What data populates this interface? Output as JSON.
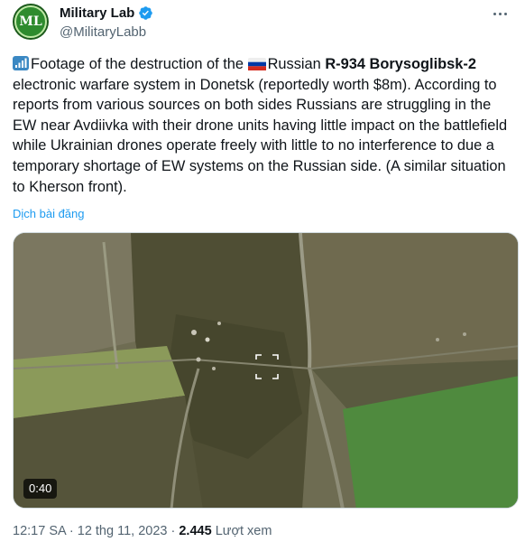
{
  "author": {
    "display_name": "Military Lab",
    "handle": "@MilitaryLabb",
    "avatar_text": "ML",
    "verified": true
  },
  "tweet": {
    "text_prefix": "Footage of the destruction of the ",
    "text_after_flag": "Russian ",
    "bold_system": "R-934 Borysoglibsk-2",
    "text_rest": " electronic warfare system in Donetsk (reportedly worth $8m). According to reports from various sources on both sides Russians are struggling in the EW near Avdiivka with their drone units having little impact on the battlefield while Ukrainian drones operate freely with little to no interference to due a temporary shortage of EW systems on the Russian side. (A similar situation to Kherson front).",
    "translate_label": "Dịch bài đăng"
  },
  "media": {
    "duration": "0:40"
  },
  "meta": {
    "time": "12:17 SA",
    "separator": " · ",
    "date": "12 thg 11, 2023",
    "views_count": "2.445",
    "views_label": "Lượt xem"
  },
  "colors": {
    "link": "#1d9bf0",
    "muted": "#536471",
    "verified": "#1d9bf0"
  },
  "icons": {
    "verified": "verified-badge-icon",
    "more": "more-options-icon",
    "signal": "signal-bars-icon",
    "flag": "russia-flag-icon"
  }
}
